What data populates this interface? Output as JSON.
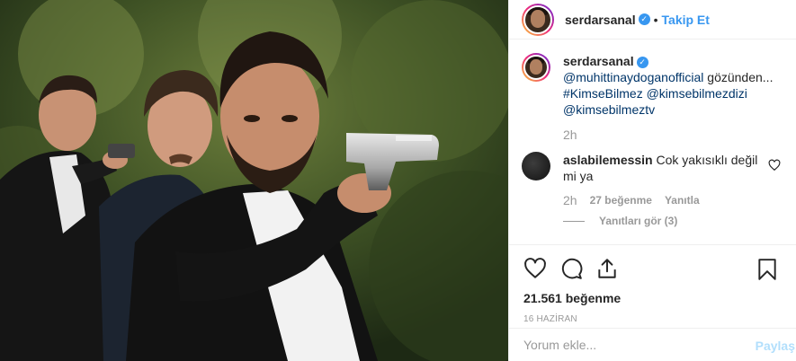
{
  "post": {
    "image_description": "",
    "header": {
      "username": "serdarsanal",
      "separator": "•",
      "follow_label": "Takip Et",
      "verified_glyph": "✓"
    },
    "caption": {
      "username": "serdarsanal",
      "mention1": "@muhittinaydoganofficial",
      "text1": " gözünden...",
      "hashtag": "#KimseBilmez",
      "mention2": "@kimsebilmezdizi",
      "mention3": "@kimsebilmeztv",
      "time": "2h"
    },
    "comment": {
      "username": "aslabilemessin",
      "text": "Cok yakısıklı değil mi ya",
      "time": "2h",
      "likes": "27 beğenme",
      "reply_label": "Yanıtla",
      "view_replies": "Yanıtları gör (3)"
    },
    "likes_count": "21.561 beğenme",
    "date": "16 HAZİRAN",
    "add_comment_placeholder": "Yorum ekle...",
    "post_button": "Paylaş"
  },
  "icons": {
    "like": "heart-icon",
    "comment": "comment-bubble-icon",
    "share": "share-icon",
    "save": "bookmark-icon",
    "comment_like": "heart-icon"
  },
  "colors": {
    "accent_blue": "#3897f0",
    "mention": "#003569",
    "muted": "#999999",
    "post_disabled": "#b2dffc"
  }
}
